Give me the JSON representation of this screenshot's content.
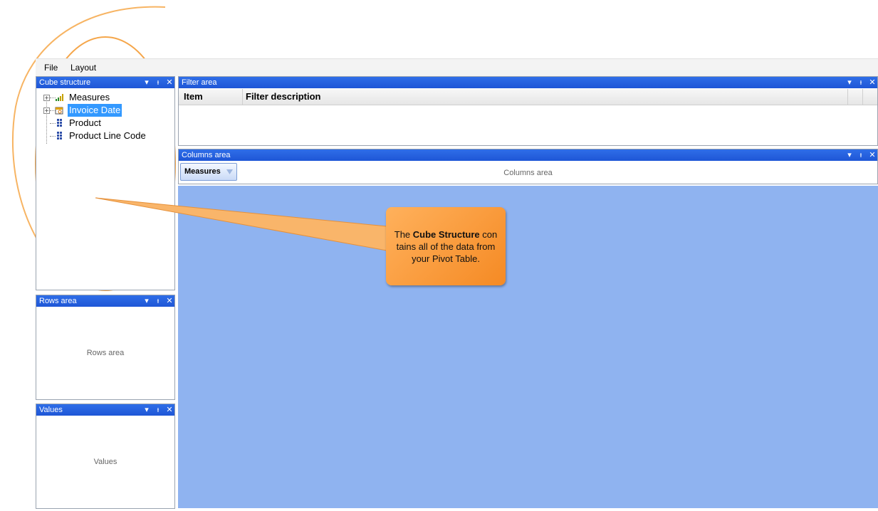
{
  "menu": {
    "file": "File",
    "layout": "Layout"
  },
  "cube_panel": {
    "title": "Cube structure",
    "items": [
      {
        "label": "Measures",
        "icon": "bar-chart-icon",
        "expandable": true,
        "selected": false
      },
      {
        "label": "Invoice Date",
        "icon": "calendar-icon",
        "expandable": true,
        "selected": true
      },
      {
        "label": "Product",
        "icon": "dimension-icon",
        "expandable": false,
        "selected": false
      },
      {
        "label": "Product Line Code",
        "icon": "dimension-icon",
        "expandable": false,
        "selected": false
      }
    ]
  },
  "rows_panel": {
    "title": "Rows area",
    "placeholder": "Rows area"
  },
  "values_panel": {
    "title": "Values",
    "placeholder": "Values"
  },
  "filter_panel": {
    "title": "Filter area",
    "col_item": "Item",
    "col_desc": "Filter description"
  },
  "columns_panel": {
    "title": "Columns area",
    "placeholder": "Columns area",
    "chip": "Measures"
  },
  "titlebar_buttons": {
    "dropdown": "▾",
    "pin": "ᵼ",
    "close": "✕"
  },
  "callout": {
    "bold": "Cube Structure",
    "pre": "The ",
    "post": " con tains all of the data from your Pivot Table."
  },
  "colors": {
    "accent": "#1e56d6",
    "pivot_area": "#8fb3f0",
    "callout": "#f58a24",
    "annotation": "#f7b463",
    "selection": "#3399ff"
  }
}
